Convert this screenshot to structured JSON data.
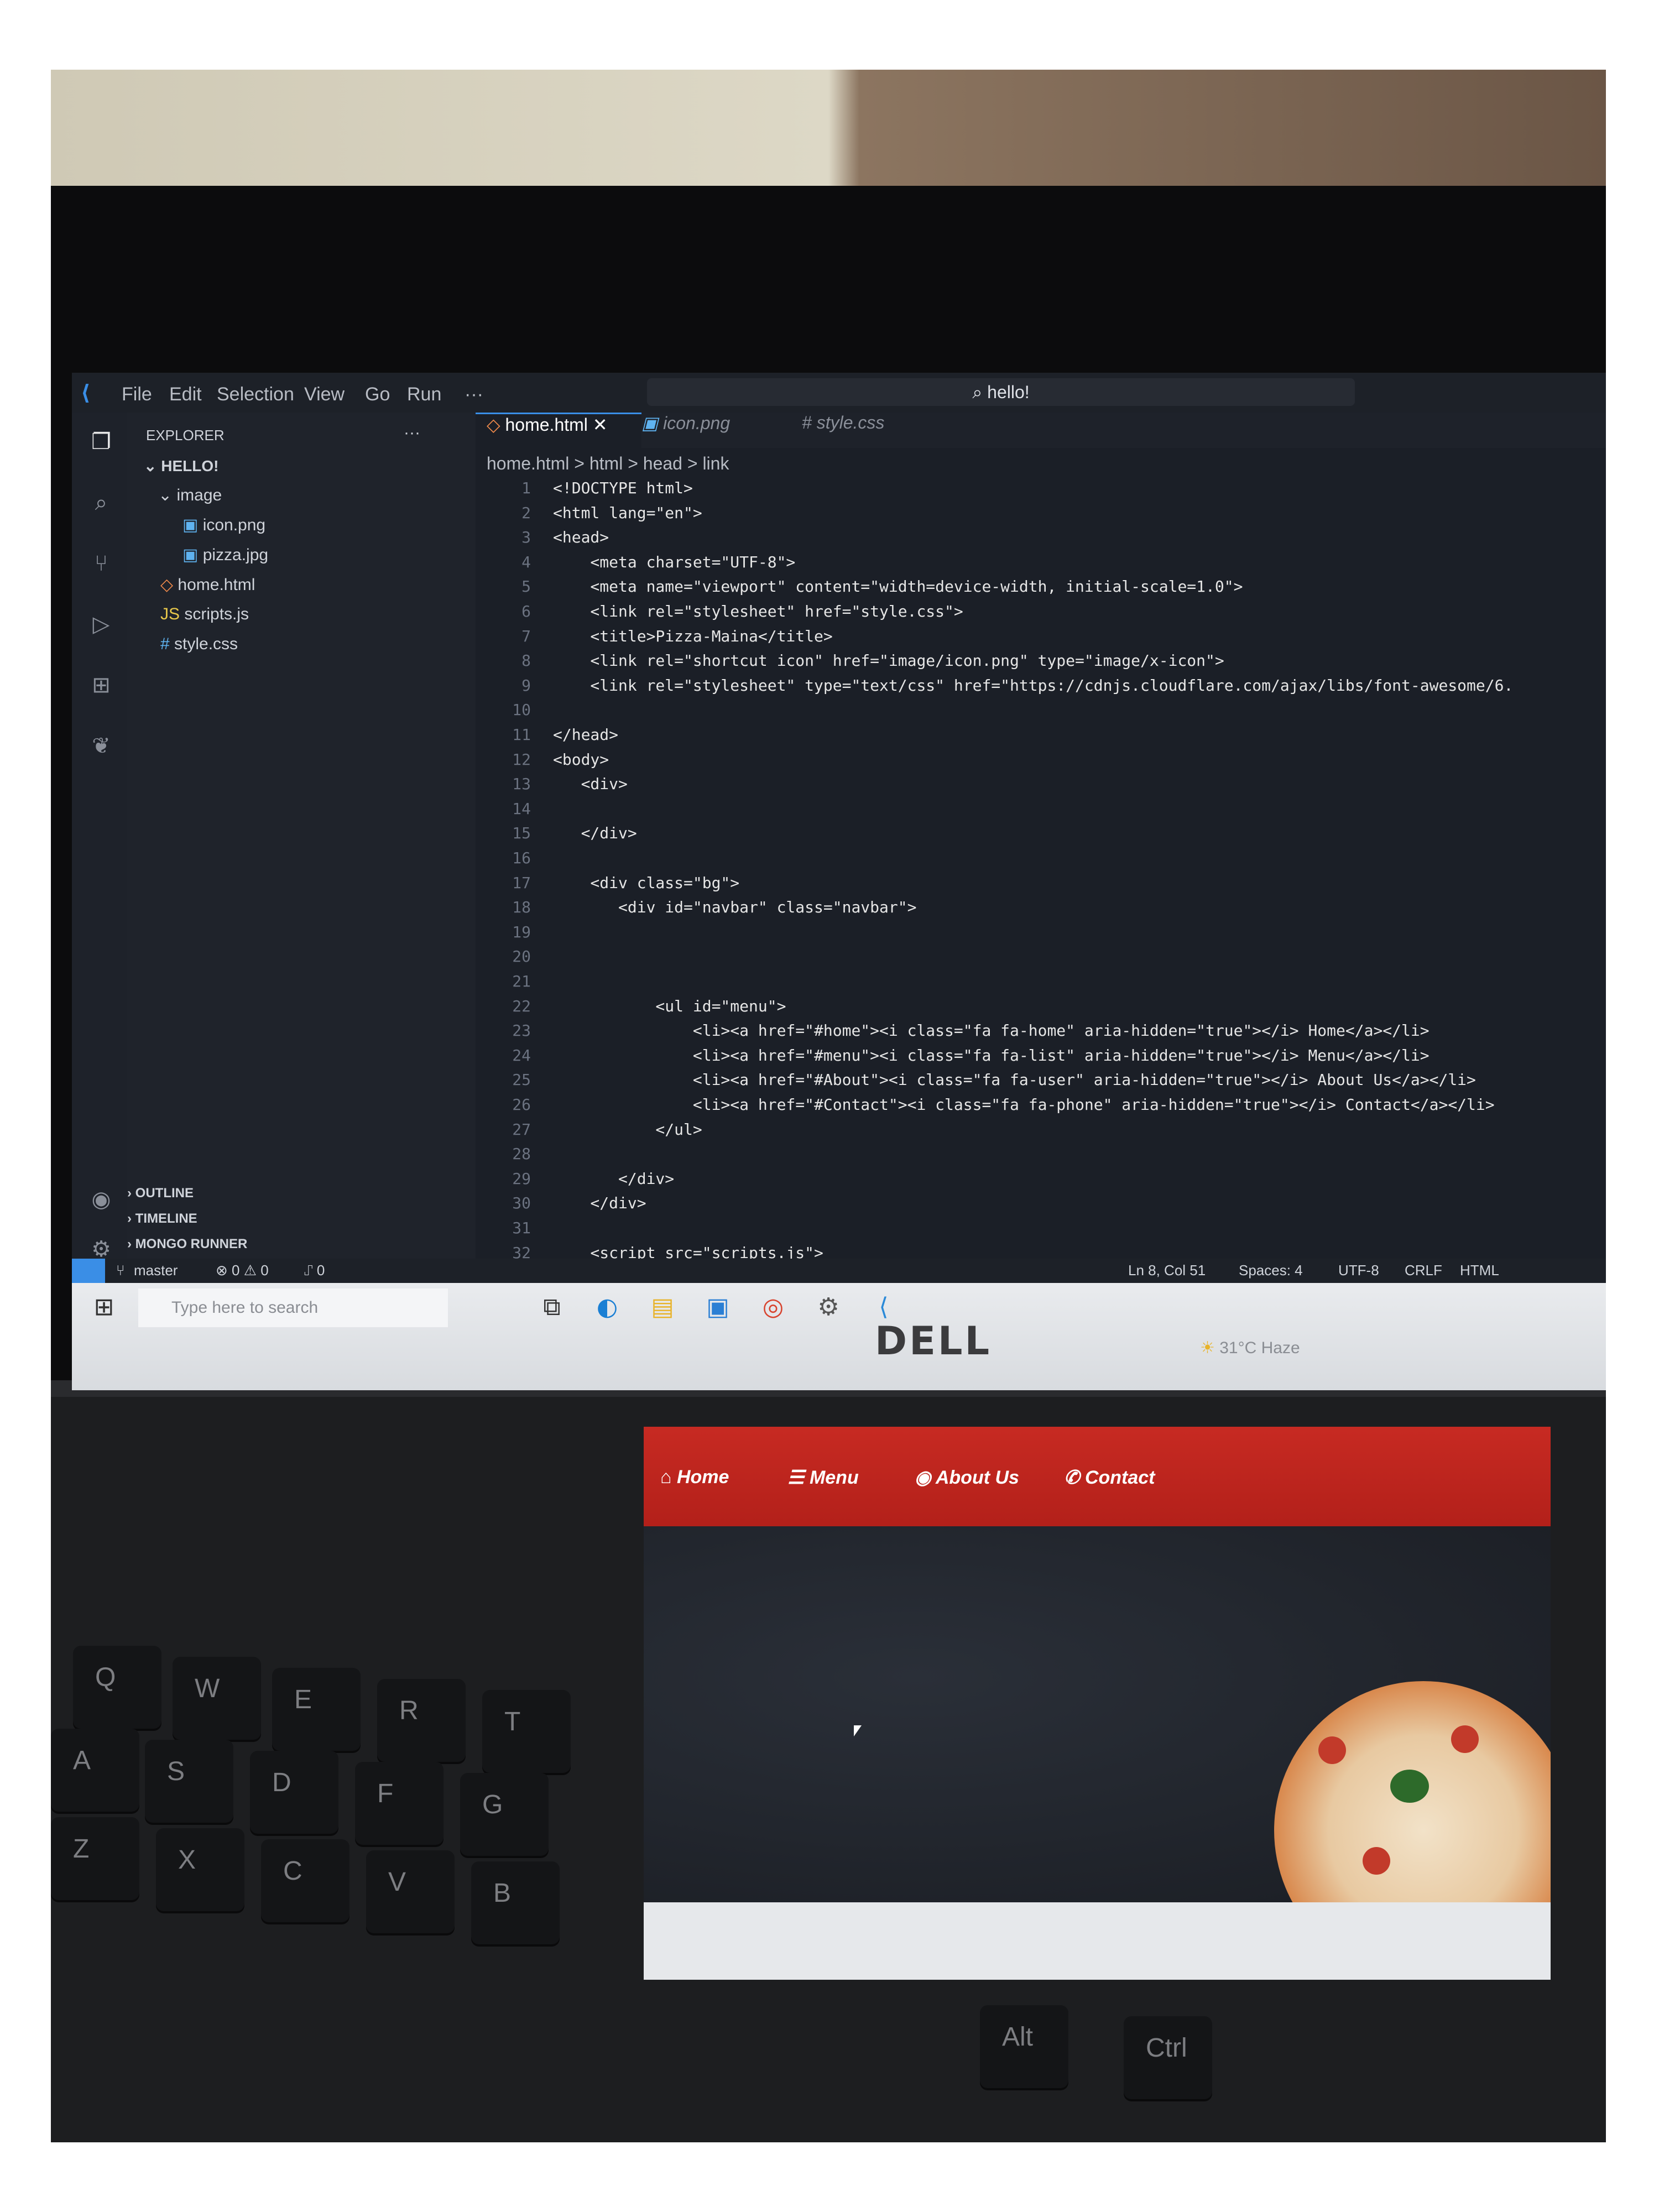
{
  "vscode": {
    "menu": [
      "File",
      "Edit",
      "Selection",
      "View",
      "Go",
      "Run",
      "···"
    ],
    "command_center": "hello!",
    "explorer_title": "EXPLORER",
    "explorer_more": "···",
    "workspace": "HELLO!",
    "tree": [
      "image",
      "icon.png",
      "pizza.jpg",
      "home.html",
      "scripts.js",
      "style.css"
    ],
    "tabs": [
      "home.html",
      "icon.png",
      "# style.css"
    ],
    "close_tab": "✕",
    "breadcrumb": "home.html > html > head > link",
    "panels": [
      "OUTLINE",
      "TIMELINE",
      "MONGO RUNNER"
    ],
    "line_numbers": [
      "1",
      "2",
      "3",
      "4",
      "5",
      "6",
      "7",
      "8",
      "9",
      "10",
      "11",
      "12",
      "13",
      "14",
      "15",
      "16",
      "17",
      "18",
      "19",
      "20",
      "21",
      "22",
      "23",
      "24",
      "25",
      "26",
      "27",
      "28",
      "29",
      "30",
      "31",
      "32"
    ],
    "code": [
      "<!DOCTYPE html>",
      "<html lang=\"en\">",
      "<head>",
      "    <meta charset=\"UTF-8\">",
      "    <meta name=\"viewport\" content=\"width=device-width, initial-scale=1.0\">",
      "    <link rel=\"stylesheet\" href=\"style.css\">",
      "    <title>Pizza-Maina</title>",
      "    <link rel=\"shortcut icon\" href=\"image/icon.png\" type=\"image/x-icon\">",
      "    <link rel=\"stylesheet\" type=\"text/css\" href=\"https://cdnjs.cloudflare.com/ajax/libs/font-awesome/6.",
      "",
      "</head>",
      "<body>",
      "   <div>",
      "",
      "   </div>",
      "",
      "    <div class=\"bg\">",
      "       <div id=\"navbar\" class=\"navbar\">",
      "",
      "",
      "",
      "           <ul id=\"menu\">",
      "               <li><a href=\"#home\"><i class=\"fa fa-home\" aria-hidden=\"true\"></i> Home</a></li>",
      "               <li><a href=\"#menu\"><i class=\"fa fa-list\" aria-hidden=\"true\"></i> Menu</a></li>",
      "               <li><a href=\"#About\"><i class=\"fa fa-user\" aria-hidden=\"true\"></i> About Us</a></li>",
      "               <li><a href=\"#Contact\"><i class=\"fa fa-phone\" aria-hidden=\"true\"></i> Contact</a></li>",
      "           </ul>",
      "",
      "       </div>",
      "    </div>",
      "",
      "    <script src=\"scripts.js\">"
    ],
    "status": {
      "branch": "master",
      "problems": "⊗ 0 ⚠ 0",
      "ports": "⑀ 0",
      "position": "Ln 8, Col 51",
      "spaces": "Spaces: 4",
      "encoding": "UTF-8",
      "eol": "CRLF",
      "language": "HTML"
    }
  },
  "taskbar": {
    "search_placeholder": "Type here to search",
    "weather": "31°C  Haze"
  },
  "laptop_brand": "DELL",
  "website": {
    "nav": [
      "Home",
      "Menu",
      "About Us",
      "Contact"
    ]
  },
  "keyboard_keys": [
    "Q",
    "W",
    "E",
    "R",
    "T",
    "A",
    "S",
    "D",
    "F",
    "G",
    "Z",
    "X",
    "C",
    "V",
    "B",
    "Alt",
    "Ctrl"
  ]
}
